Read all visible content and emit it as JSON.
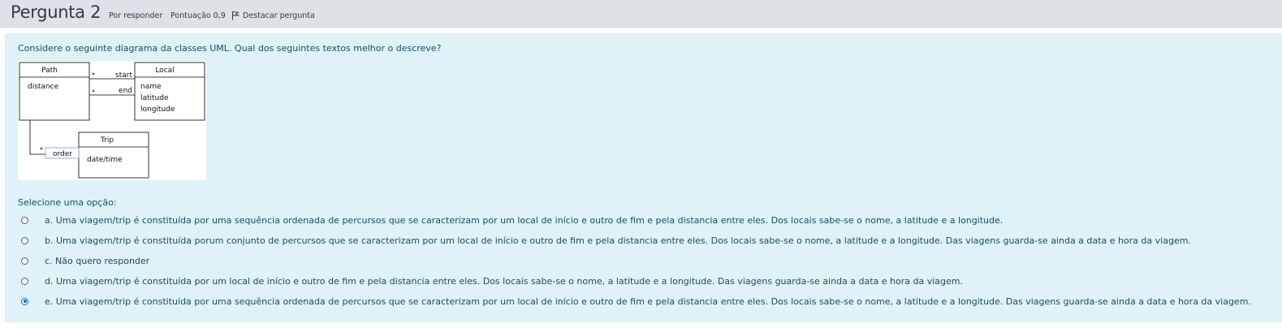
{
  "question": {
    "title": "Pergunta 2",
    "status": "Por responder",
    "score": "Pontuação 0,9",
    "flag_label": "Destacar pergunta",
    "text": "Considere o seguinte diagrama da classes UML. Qual dos seguintes textos melhor o descreve?",
    "prompt": "Selecione uma opção:"
  },
  "diagram": {
    "path_title": "Path",
    "path_attr": "distance",
    "local_title": "Local",
    "local_attrs": [
      "name",
      "latitude",
      "longitude"
    ],
    "trip_title": "Trip",
    "trip_attr": "date/time",
    "assoc_start": "start",
    "assoc_end": "end",
    "assoc_order": "order",
    "multiplicity": "*"
  },
  "options": [
    {
      "text": "a. Uma viagem/trip é constituída por uma sequência ordenada de percursos que se caracterizam por um local de início e outro de fim e pela distancia entre eles. Dos locais sabe-se o nome, a latitude e a longitude.",
      "selected": false
    },
    {
      "text": "b. Uma viagem/trip é constituída porum conjunto de percursos que se caracterizam por um local de início e outro de fim e pela distancia entre eles. Dos locais sabe-se o nome, a latitude e a longitude. Das viagens guarda-se ainda a data e hora da viagem.",
      "selected": false
    },
    {
      "text": "c. Não quero responder",
      "selected": false
    },
    {
      "text": "d. Uma viagem/trip é constituída por um local de início e outro de fim e pela distancia entre eles. Dos locais sabe-se o nome, a latitude e a longitude. Das viagens guarda-se ainda a data e hora da viagem.",
      "selected": false
    },
    {
      "text": "e. Uma viagem/trip é constituída por uma sequência ordenada de percursos que se caracterizam por um local de início e outro de fim e pela distancia entre eles. Dos locais sabe-se o nome, a latitude e a longitude. Das viagens guarda-se ainda a data e hora da viagem.",
      "selected": true
    }
  ],
  "colors": {
    "header_bg": "#dee2e6",
    "content_bg": "#def2f8",
    "text": "#1b4d5c",
    "radio_selected": "#0f6cbf"
  },
  "icons": {
    "flag": "flag-icon"
  }
}
